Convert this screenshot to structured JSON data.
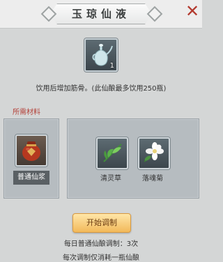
{
  "header": {
    "title": "玉琼仙液",
    "close_icon": "close-icon"
  },
  "product": {
    "icon": "wine-pot-icon",
    "quantity": "1",
    "description": "饮用后增加筋骨。(此仙酿最多饮用250瓶)"
  },
  "materials": {
    "section_label": "所需材料",
    "base": {
      "icon": "wine-jar-icon",
      "name": "普通仙浆"
    },
    "items": [
      {
        "icon": "herb-icon",
        "name": "清灵草"
      },
      {
        "icon": "jasmine-flower-icon",
        "name": "落魂菊"
      }
    ]
  },
  "actions": {
    "start_label": "开始调制"
  },
  "info": {
    "daily_limit": "每日普通仙酿调制：3次",
    "cost_note": "每次调制仅消耗一瓶仙酿"
  },
  "colors": {
    "accent": "#f2b95a",
    "section_label": "#b4423a",
    "close": "#b33a2f"
  }
}
